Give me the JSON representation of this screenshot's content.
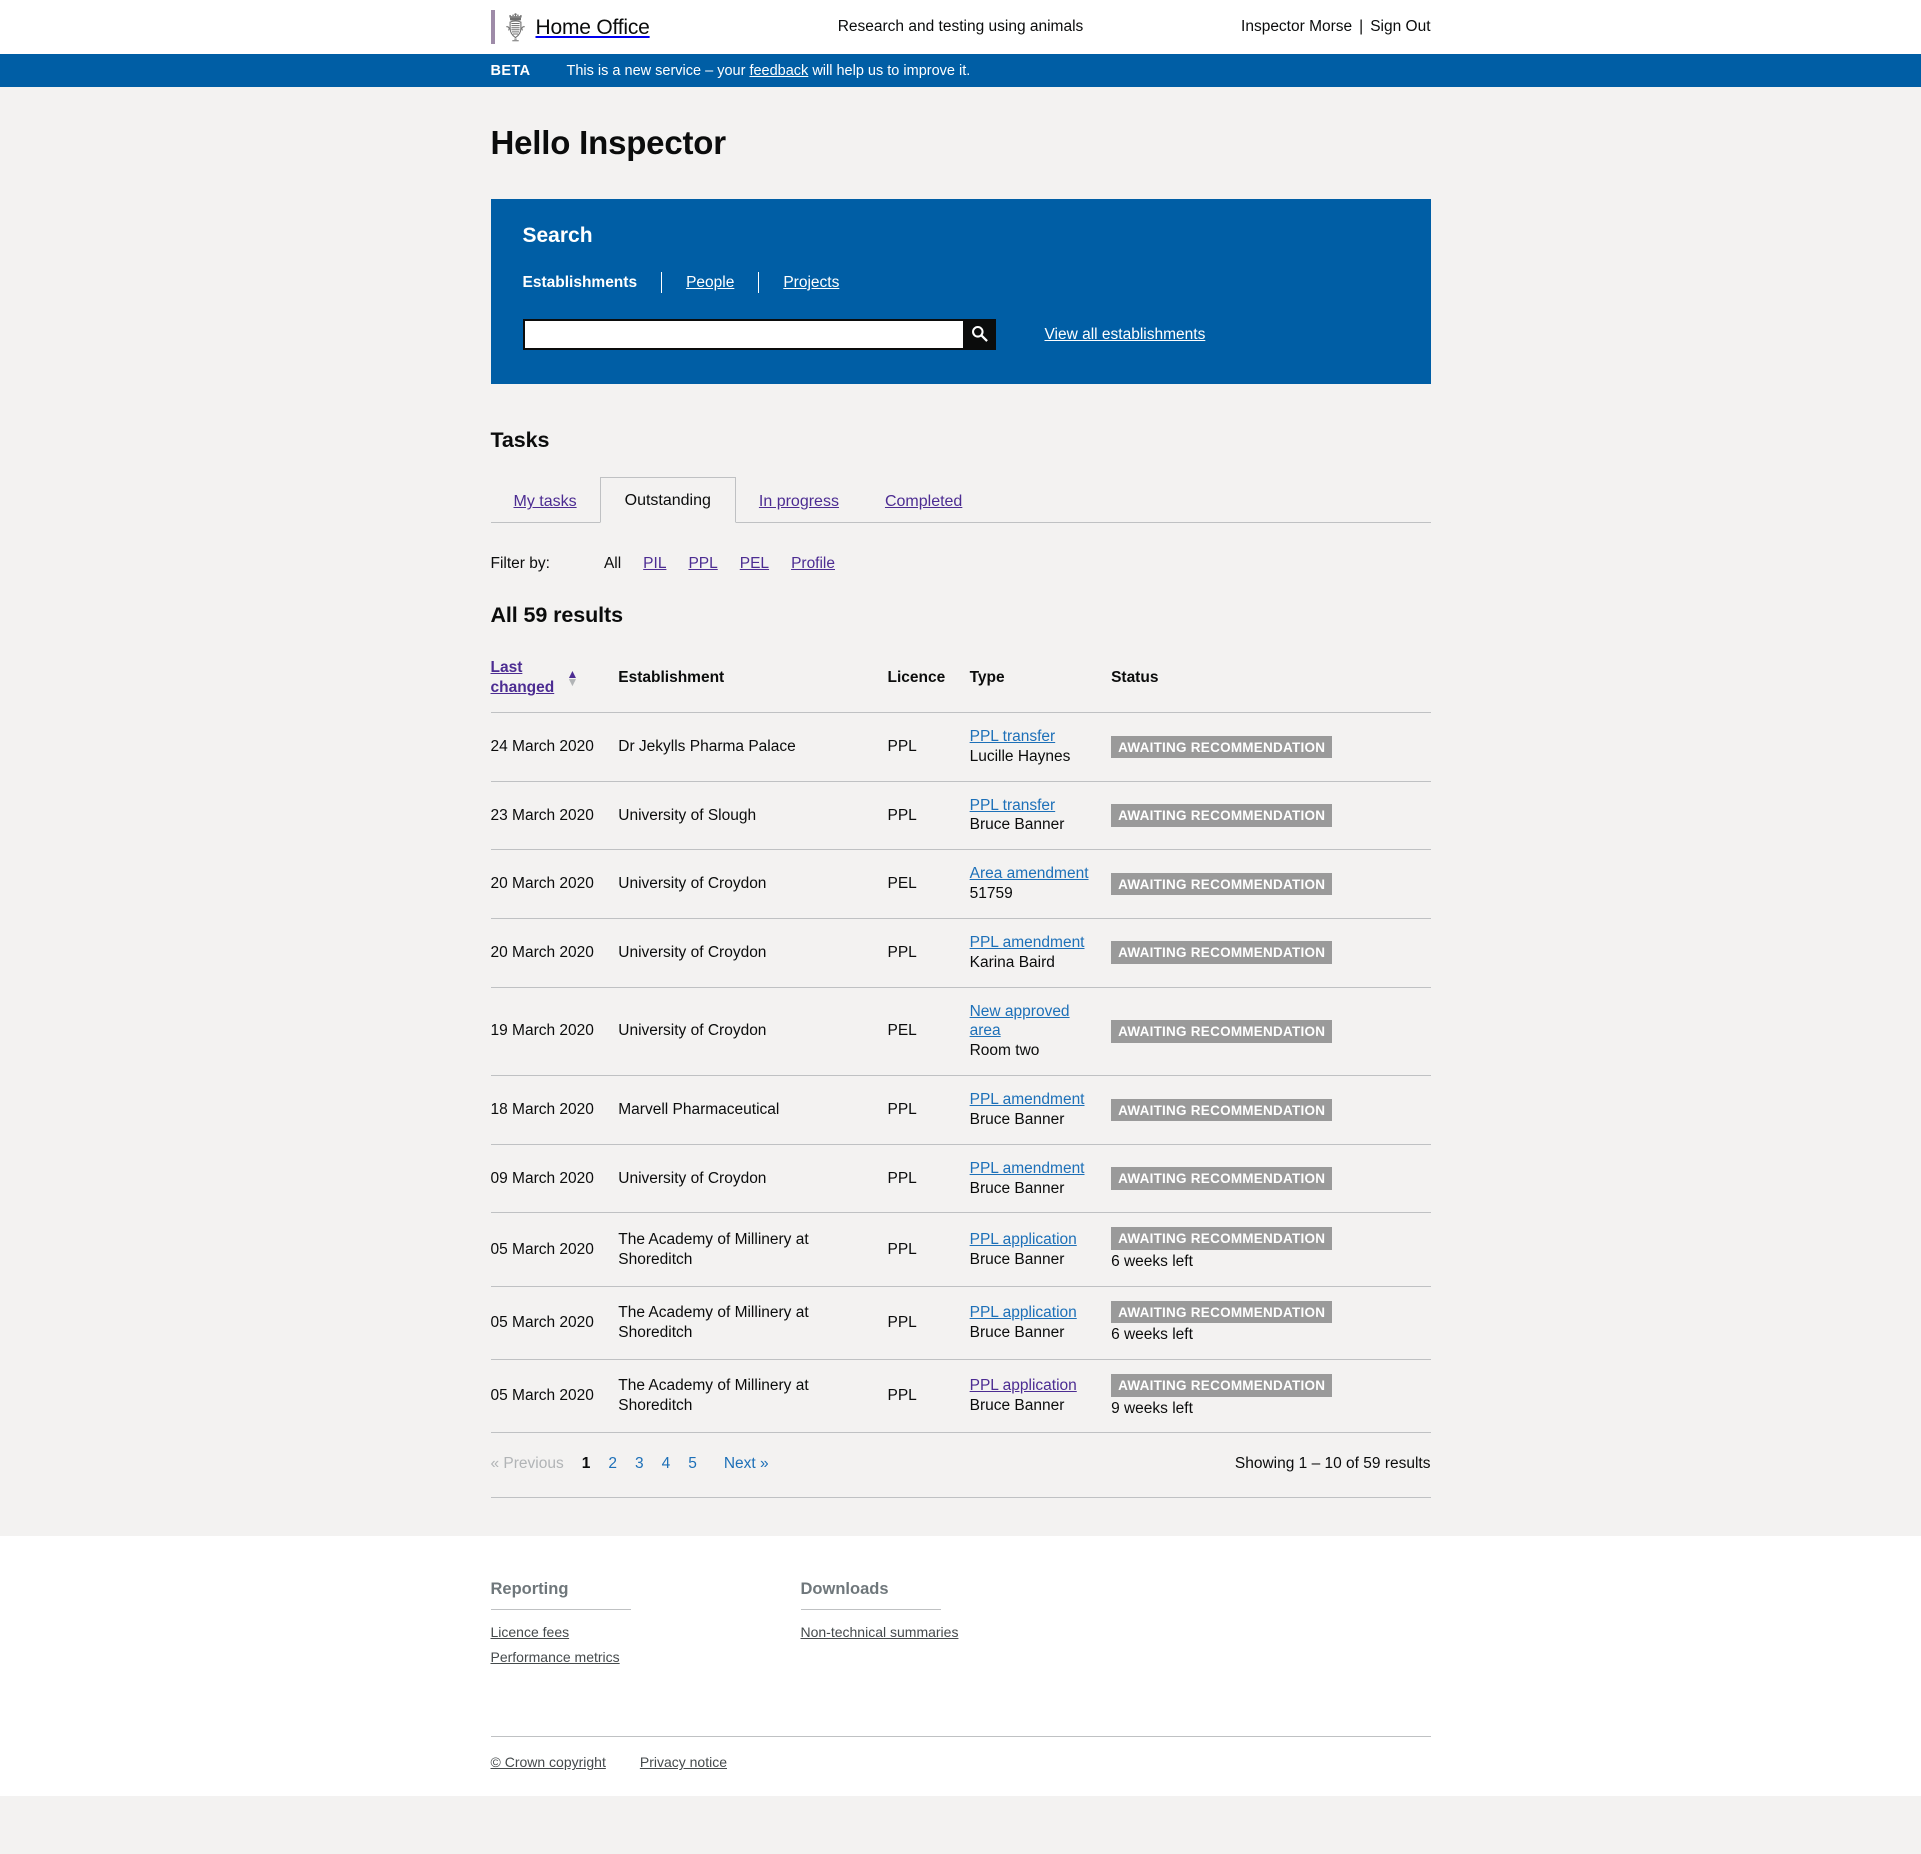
{
  "header": {
    "brand": "Home Office",
    "service_name": "Research and testing using animals",
    "user": "Inspector Morse",
    "separator": "|",
    "sign_out": "Sign Out",
    "crest_icon": "royal-crest-icon"
  },
  "phase_banner": {
    "tag": "BETA",
    "text_before": "This is a new service – your ",
    "link": "feedback",
    "text_after": " will help us to improve it."
  },
  "page": {
    "title": "Hello Inspector"
  },
  "search": {
    "heading": "Search",
    "tabs": [
      "Establishments",
      "People",
      "Projects"
    ],
    "input_value": "",
    "input_placeholder": "",
    "search_icon": "search-icon",
    "view_all_label": "View all establishments",
    "panel_color": "#005ea5"
  },
  "tasks": {
    "heading": "Tasks",
    "tabs": [
      {
        "label": "My tasks",
        "selected": false
      },
      {
        "label": "Outstanding",
        "selected": true
      },
      {
        "label": "In progress",
        "selected": false
      },
      {
        "label": "Completed",
        "selected": false
      }
    ],
    "filter": {
      "label": "Filter by:",
      "options": [
        {
          "label": "All",
          "active": true
        },
        {
          "label": "PIL",
          "active": false
        },
        {
          "label": "PPL",
          "active": false
        },
        {
          "label": "PEL",
          "active": false
        },
        {
          "label": "Profile",
          "active": false
        }
      ]
    },
    "results_heading": "All 59 results",
    "columns": {
      "last_changed": "Last changed",
      "establishment": "Establishment",
      "licence": "Licence",
      "type": "Type",
      "status": "Status"
    },
    "sort": {
      "ascending_icon": "sort-ascending-icon",
      "descending_icon": "sort-descending-icon"
    },
    "rows": [
      {
        "date": "24 March 2020",
        "establishment": "Dr Jekylls Pharma Palace",
        "licence": "PPL",
        "type_link": "PPL transfer",
        "type_sub": "Lucille Haynes",
        "type_visited": false,
        "status": "AWAITING RECOMMENDATION",
        "status_sub": ""
      },
      {
        "date": "23 March 2020",
        "establishment": "University of Slough",
        "licence": "PPL",
        "type_link": "PPL transfer",
        "type_sub": "Bruce Banner",
        "type_visited": false,
        "status": "AWAITING RECOMMENDATION",
        "status_sub": ""
      },
      {
        "date": "20 March 2020",
        "establishment": "University of Croydon",
        "licence": "PEL",
        "type_link": "Area amendment",
        "type_sub": "51759",
        "type_visited": false,
        "status": "AWAITING RECOMMENDATION",
        "status_sub": ""
      },
      {
        "date": "20 March 2020",
        "establishment": "University of Croydon",
        "licence": "PPL",
        "type_link": "PPL amendment",
        "type_sub": "Karina Baird",
        "type_visited": false,
        "status": "AWAITING RECOMMENDATION",
        "status_sub": ""
      },
      {
        "date": "19 March 2020",
        "establishment": "University of Croydon",
        "licence": "PEL",
        "type_link": "New approved area",
        "type_sub": "Room two",
        "type_visited": false,
        "status": "AWAITING RECOMMENDATION",
        "status_sub": ""
      },
      {
        "date": "18 March 2020",
        "establishment": "Marvell Pharmaceutical",
        "licence": "PPL",
        "type_link": "PPL amendment",
        "type_sub": "Bruce Banner",
        "type_visited": false,
        "status": "AWAITING RECOMMENDATION",
        "status_sub": ""
      },
      {
        "date": "09 March 2020",
        "establishment": "University of Croydon",
        "licence": "PPL",
        "type_link": "PPL amendment",
        "type_sub": "Bruce Banner",
        "type_visited": false,
        "status": "AWAITING RECOMMENDATION",
        "status_sub": ""
      },
      {
        "date": "05 March 2020",
        "establishment": "The Academy of Millinery at Shoreditch",
        "licence": "PPL",
        "type_link": "PPL application",
        "type_sub": "Bruce Banner",
        "type_visited": false,
        "status": "AWAITING RECOMMENDATION",
        "status_sub": "6 weeks left"
      },
      {
        "date": "05 March 2020",
        "establishment": "The Academy of Millinery at Shoreditch",
        "licence": "PPL",
        "type_link": "PPL application",
        "type_sub": "Bruce Banner",
        "type_visited": false,
        "status": "AWAITING RECOMMENDATION",
        "status_sub": "6 weeks left"
      },
      {
        "date": "05 March 2020",
        "establishment": "The Academy of Millinery at Shoreditch",
        "licence": "PPL",
        "type_link": "PPL application",
        "type_sub": "Bruce Banner",
        "type_visited": true,
        "status": "AWAITING RECOMMENDATION",
        "status_sub": "9 weeks left"
      }
    ],
    "pagination": {
      "previous": "« Previous",
      "pages": [
        {
          "label": "1",
          "current": true
        },
        {
          "label": "2",
          "current": false
        },
        {
          "label": "3",
          "current": false
        },
        {
          "label": "4",
          "current": false
        },
        {
          "label": "5",
          "current": false
        }
      ],
      "next": "Next »",
      "showing": "Showing 1 – 10 of 59 results"
    }
  },
  "footer": {
    "columns": [
      {
        "heading": "Reporting",
        "links": [
          "Licence fees",
          "Performance metrics"
        ]
      },
      {
        "heading": "Downloads",
        "links": [
          "Non-technical summaries"
        ]
      }
    ],
    "bottom_links": [
      "© Crown copyright",
      "Privacy notice"
    ]
  }
}
